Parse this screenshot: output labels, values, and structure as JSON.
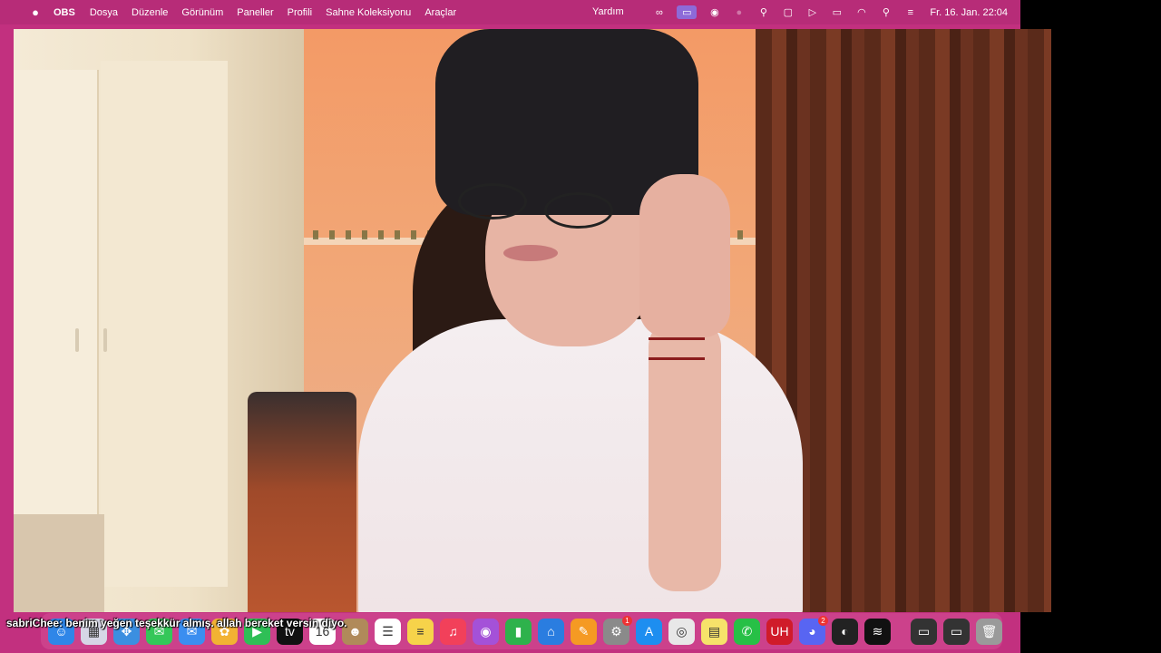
{
  "menubar": {
    "app_name": "OBS",
    "items": [
      "Dosya",
      "Düzenle",
      "Görünüm",
      "Paneller",
      "Profili",
      "Sahne Koleksiyonu",
      "Araçlar"
    ],
    "help": "Yardım",
    "clock": "Fr. 16. Jan. 22:04",
    "status_icons": [
      "creative-cloud-icon",
      "screen-share-icon",
      "eye-icon",
      "record-icon",
      "antenna-icon",
      "window-icon",
      "play-circle-icon",
      "battery-icon",
      "wifi-icon",
      "search-icon",
      "control-center-icon"
    ]
  },
  "chat": {
    "username": "sabriChee",
    "message": ": benim yeğen teşekkür almış. allah bereket versin diyo."
  },
  "dock": {
    "apps": [
      {
        "name": "finder-icon",
        "glyph": "☺",
        "color": "#2f86e8"
      },
      {
        "name": "launchpad-icon",
        "glyph": "▦",
        "color": "#d6d6e6"
      },
      {
        "name": "safari-icon",
        "glyph": "✥",
        "color": "#3b8fe0"
      },
      {
        "name": "messages-icon",
        "glyph": "✉",
        "color": "#34c759"
      },
      {
        "name": "mail-icon",
        "glyph": "✉",
        "color": "#3a8ef0"
      },
      {
        "name": "photos-icon",
        "glyph": "✿",
        "color": "#f2b233"
      },
      {
        "name": "facetime-icon",
        "glyph": "▶",
        "color": "#2fbf56"
      },
      {
        "name": "appletv-icon",
        "glyph": "tv",
        "color": "#111111"
      },
      {
        "name": "calendar-icon",
        "glyph": "16",
        "color": "#ffffff"
      },
      {
        "name": "contacts-icon",
        "glyph": "☻",
        "color": "#b08a5a"
      },
      {
        "name": "reminders-icon",
        "glyph": "☰",
        "color": "#ffffff"
      },
      {
        "name": "notes-icon",
        "glyph": "≡",
        "color": "#f6d34a"
      },
      {
        "name": "music-icon",
        "glyph": "♫",
        "color": "#f2405a"
      },
      {
        "name": "podcasts-icon",
        "glyph": "◉",
        "color": "#a451d8"
      },
      {
        "name": "numbers-icon",
        "glyph": "▮",
        "color": "#2eb24c"
      },
      {
        "name": "keynote-icon",
        "glyph": "⌂",
        "color": "#2a7de0"
      },
      {
        "name": "pages-icon",
        "glyph": "✎",
        "color": "#f59a23"
      },
      {
        "name": "system-settings-icon",
        "glyph": "⚙",
        "color": "#8a8a8a",
        "badge": "1"
      },
      {
        "name": "app-store-icon",
        "glyph": "A",
        "color": "#1d8ef0"
      },
      {
        "name": "chrome-icon",
        "glyph": "◎",
        "color": "#e8e8e8"
      },
      {
        "name": "stickies-icon",
        "glyph": "▤",
        "color": "#f6e26a"
      },
      {
        "name": "whatsapp-icon",
        "glyph": "✆",
        "color": "#27c046"
      },
      {
        "name": "uh-app-icon",
        "glyph": "UH",
        "color": "#d01b2a"
      },
      {
        "name": "discord-icon",
        "glyph": "◕",
        "color": "#5865f2",
        "badge": "2"
      },
      {
        "name": "obs-icon",
        "glyph": "◐",
        "color": "#222222"
      },
      {
        "name": "spotify-icon",
        "glyph": "≋",
        "color": "#111111"
      }
    ],
    "extras": [
      {
        "name": "window-preview-1-icon",
        "glyph": "▭",
        "color": "#333333"
      },
      {
        "name": "window-preview-2-icon",
        "glyph": "▭",
        "color": "#333333"
      },
      {
        "name": "trash-icon",
        "glyph": "🗑",
        "color": "#9a9a9a"
      }
    ]
  }
}
